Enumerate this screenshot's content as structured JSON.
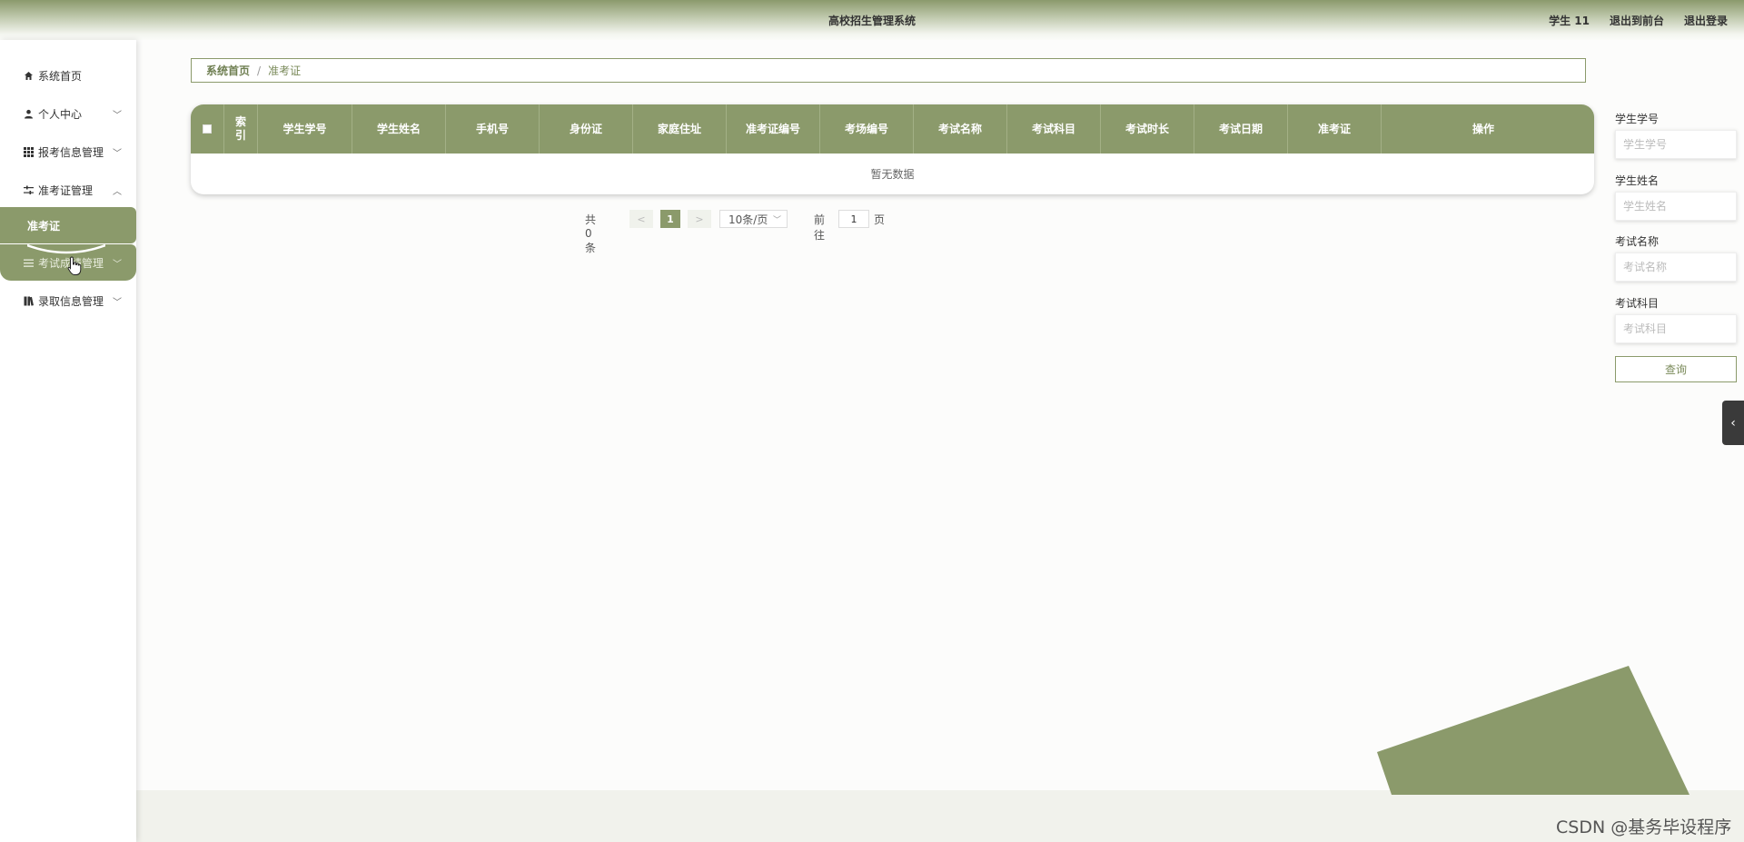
{
  "header": {
    "title": "高校招生管理系统",
    "user": "学生 11",
    "back_front": "退出到前台",
    "logout": "退出登录"
  },
  "sidebar": {
    "items": [
      {
        "label": "系统首页",
        "icon": "home-icon"
      },
      {
        "label": "个人中心",
        "icon": "person-icon"
      },
      {
        "label": "报考信息管理",
        "icon": "grid-icon"
      },
      {
        "label": "准考证管理",
        "icon": "sliders-icon"
      },
      {
        "label": "准考证",
        "icon": ""
      },
      {
        "label": "考试成绩管理",
        "icon": "list-icon"
      },
      {
        "label": "录取信息管理",
        "icon": "book-icon"
      }
    ]
  },
  "breadcrumb": {
    "home": "系统首页",
    "separator": "/",
    "current": "准考证"
  },
  "table": {
    "columns": [
      "索引",
      "学生学号",
      "学生姓名",
      "手机号",
      "身份证",
      "家庭住址",
      "准考证编号",
      "考场编号",
      "考试名称",
      "考试科目",
      "考试时长",
      "考试日期",
      "准考证",
      "操作"
    ],
    "index_col": [
      "索",
      "引"
    ],
    "empty_text": "暂无数据"
  },
  "pagination": {
    "total": "共 0 条",
    "prev": "<",
    "current_page": "1",
    "next": ">",
    "page_size": "10条/页",
    "goto": "前往",
    "goto_value": "1",
    "page_unit": "页"
  },
  "search": {
    "student_no_label": "学生学号",
    "student_no_placeholder": "学生学号",
    "student_name_label": "学生姓名",
    "student_name_placeholder": "学生姓名",
    "exam_name_label": "考试名称",
    "exam_name_placeholder": "考试名称",
    "exam_subject_label": "考试科目",
    "exam_subject_placeholder": "考试科目",
    "button": "查询"
  },
  "watermark": "CSDN @基务毕设程序",
  "colors": {
    "accent": "#8b9a6b",
    "accent_dark": "#6f7f52",
    "background": "#fcfcfb"
  }
}
